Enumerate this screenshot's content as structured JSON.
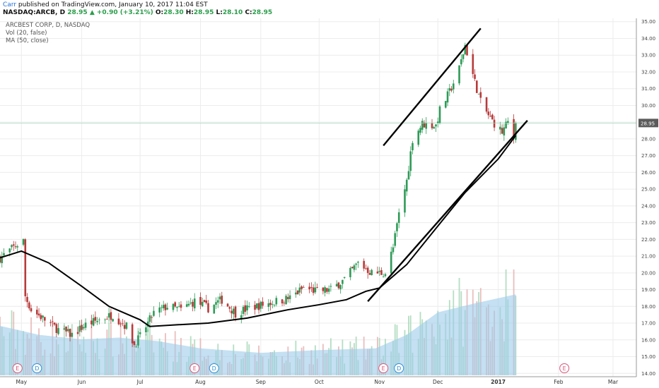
{
  "header": {
    "author": "Carr",
    "published": "published on TradingView.com, January 10, 2017 11:04 EST",
    "symbol": "NASDAQ:ARCB, D",
    "last": "28.95",
    "arrow": "▲",
    "change": "+0.90 (+3.21%)",
    "o_label": "O:",
    "o_value": "28.30",
    "h_label": "H:",
    "h_value": "28.95",
    "l_label": "L:",
    "l_value": "28.10",
    "c_label": "C:",
    "c_value": "28.95"
  },
  "legend": {
    "title": "ARCBEST CORP, D, NASDAQ",
    "vol": "Vol (20, false)",
    "ma": "MA (50, close)"
  },
  "colors": {
    "up": "#2e9b57",
    "down": "#b83a3a",
    "volume": "#9ccbea",
    "trendline": "#000000",
    "ma": "#000000",
    "price_label_bg": "#5b5b5b"
  },
  "icons": [
    "earnings-icon",
    "dividend-icon"
  ],
  "chart_data": {
    "type": "candlestick",
    "title": "ARCBEST CORP, D, NASDAQ",
    "ylim": [
      13.8,
      35.2
    ],
    "y_ticks": [
      "14.00",
      "15.00",
      "16.00",
      "17.00",
      "18.00",
      "19.00",
      "20.00",
      "21.00",
      "22.00",
      "23.00",
      "24.00",
      "25.00",
      "26.00",
      "27.00",
      "28.00",
      "29.00",
      "30.00",
      "31.00",
      "32.00",
      "33.00",
      "34.00",
      "35.00"
    ],
    "x_ticks": [
      "May",
      "Jun",
      "Jul",
      "Aug",
      "Sep",
      "Oct",
      "Nov",
      "Dec",
      "2017",
      "Feb",
      "Mar"
    ],
    "last_price_label": "28.95",
    "price_anchors": [
      [
        "2016-04-20",
        20.9
      ],
      [
        "2016-04-29",
        21.7
      ],
      [
        "2016-05-02",
        21.9
      ],
      [
        "2016-05-03",
        18.6
      ],
      [
        "2016-05-06",
        17.8
      ],
      [
        "2016-05-13",
        17.2
      ],
      [
        "2016-05-20",
        16.6
      ],
      [
        "2016-05-27",
        16.3
      ],
      [
        "2016-06-03",
        16.9
      ],
      [
        "2016-06-10",
        17.2
      ],
      [
        "2016-06-17",
        17.5
      ],
      [
        "2016-06-24",
        16.8
      ],
      [
        "2016-06-28",
        15.7
      ],
      [
        "2016-07-01",
        16.2
      ],
      [
        "2016-07-08",
        17.6
      ],
      [
        "2016-07-15",
        18.0
      ],
      [
        "2016-07-22",
        17.8
      ],
      [
        "2016-07-29",
        18.3
      ],
      [
        "2016-08-05",
        17.9
      ],
      [
        "2016-08-12",
        18.4
      ],
      [
        "2016-08-19",
        17.6
      ],
      [
        "2016-08-26",
        17.9
      ],
      [
        "2016-09-02",
        18.1
      ],
      [
        "2016-09-09",
        18.3
      ],
      [
        "2016-09-16",
        18.5
      ],
      [
        "2016-09-23",
        19.1
      ],
      [
        "2016-09-30",
        18.9
      ],
      [
        "2016-10-07",
        19.0
      ],
      [
        "2016-10-14",
        19.6
      ],
      [
        "2016-10-21",
        20.6
      ],
      [
        "2016-10-28",
        20.0
      ],
      [
        "2016-11-04",
        20.0
      ],
      [
        "2016-11-08",
        21.5
      ],
      [
        "2016-11-11",
        23.5
      ],
      [
        "2016-11-15",
        25.5
      ],
      [
        "2016-11-18",
        28.0
      ],
      [
        "2016-11-23",
        28.9
      ],
      [
        "2016-11-30",
        28.8
      ],
      [
        "2016-12-02",
        29.7
      ],
      [
        "2016-12-07",
        30.8
      ],
      [
        "2016-12-12",
        32.2
      ],
      [
        "2016-12-15",
        33.6
      ],
      [
        "2016-12-20",
        31.4
      ],
      [
        "2016-12-23",
        30.2
      ],
      [
        "2016-12-28",
        29.2
      ],
      [
        "2017-01-03",
        28.4
      ],
      [
        "2017-01-06",
        29.0
      ],
      [
        "2017-01-09",
        28.1
      ],
      [
        "2017-01-10",
        28.95
      ]
    ],
    "ma_50": [
      [
        "2016-04-20",
        20.9
      ],
      [
        "2016-05-01",
        21.3
      ],
      [
        "2016-05-15",
        20.6
      ],
      [
        "2016-06-01",
        19.2
      ],
      [
        "2016-06-15",
        18.0
      ],
      [
        "2016-07-01",
        17.2
      ],
      [
        "2016-07-06",
        16.8
      ],
      [
        "2016-07-20",
        16.9
      ],
      [
        "2016-08-05",
        17.0
      ],
      [
        "2016-08-25",
        17.3
      ],
      [
        "2016-09-15",
        17.8
      ],
      [
        "2016-10-01",
        18.1
      ],
      [
        "2016-10-15",
        18.4
      ],
      [
        "2016-10-25",
        18.9
      ],
      [
        "2016-11-01",
        19.1
      ],
      [
        "2016-11-15",
        20.5
      ],
      [
        "2016-12-01",
        22.8
      ],
      [
        "2016-12-15",
        24.8
      ],
      [
        "2017-01-01",
        26.8
      ],
      [
        "2017-01-10",
        28.2
      ]
    ],
    "trendlines": [
      {
        "from": [
          "2016-11-03",
          27.6
        ],
        "to": [
          "2016-12-23",
          34.6
        ]
      },
      {
        "from": [
          "2016-10-26",
          18.3
        ],
        "to": [
          "2017-01-16",
          29.1
        ]
      }
    ],
    "volume_level": [
      [
        "2016-04-20",
        0.55
      ],
      [
        "2016-05-10",
        0.45
      ],
      [
        "2016-06-01",
        0.4
      ],
      [
        "2016-06-20",
        0.42
      ],
      [
        "2016-07-10",
        0.38
      ],
      [
        "2016-08-01",
        0.3
      ],
      [
        "2016-09-01",
        0.25
      ],
      [
        "2016-10-01",
        0.28
      ],
      [
        "2016-10-30",
        0.3
      ],
      [
        "2016-11-15",
        0.45
      ],
      [
        "2016-12-01",
        0.7
      ],
      [
        "2016-12-20",
        0.8
      ],
      [
        "2017-01-10",
        0.9
      ]
    ],
    "events": [
      {
        "date": "2016-04-29",
        "letter": "E"
      },
      {
        "date": "2016-05-09",
        "letter": "D"
      },
      {
        "date": "2016-07-29",
        "letter": "E"
      },
      {
        "date": "2016-08-08",
        "letter": "D"
      },
      {
        "date": "2016-11-03",
        "letter": "E"
      },
      {
        "date": "2016-11-11",
        "letter": "D"
      },
      {
        "date": "2017-02-04",
        "letter": "E"
      }
    ]
  }
}
